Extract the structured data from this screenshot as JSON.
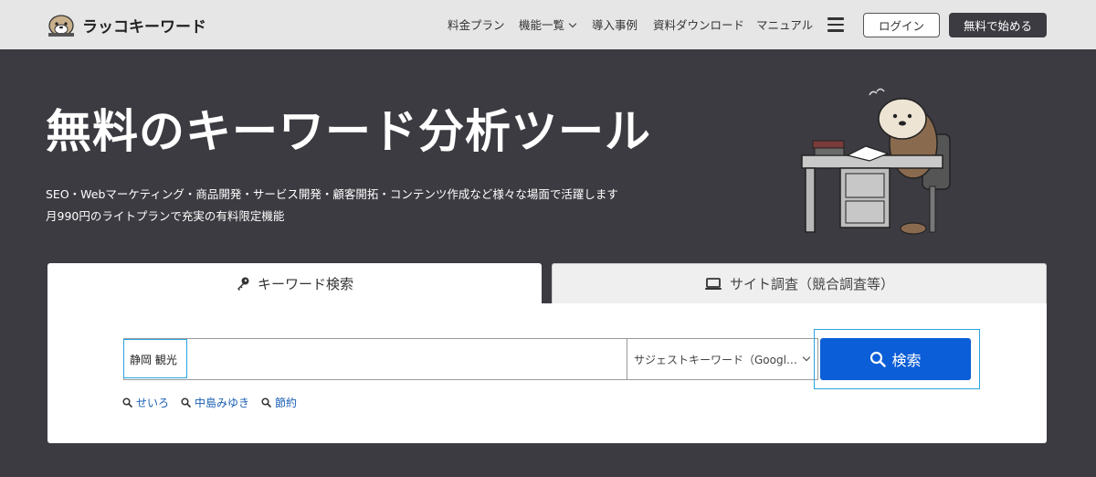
{
  "header": {
    "logo_text": "ラッコキーワード",
    "nav": [
      {
        "label": "料金プラン"
      },
      {
        "label": "機能一覧"
      },
      {
        "label": "導入事例"
      },
      {
        "label": "資料ダウンロード"
      },
      {
        "label": "マニュアル"
      }
    ],
    "login_label": "ログイン",
    "start_label": "無料で始める"
  },
  "hero": {
    "title": "無料のキーワード分析ツール",
    "subtitle1": "SEO・Webマーケティング・商品開発・サービス開発・顧客開拓・コンテンツ作成など様々な場面で活躍します",
    "subtitle2": "月990円のライトプランで充実の有料限定機能"
  },
  "tabs": {
    "keyword": "キーワード検索",
    "site": "サイト調査（競合調査等）"
  },
  "search": {
    "value": "静岡 観光",
    "select_value": "サジェストキーワード（Googl…",
    "button_label": "検索"
  },
  "suggestions": [
    "せいろ",
    "中島みゆき",
    "節約"
  ],
  "colors": {
    "header_bg": "#e6e6e6",
    "hero_bg": "#3c3b41",
    "primary": "#0b5ed7",
    "link": "#1a5fb4"
  }
}
